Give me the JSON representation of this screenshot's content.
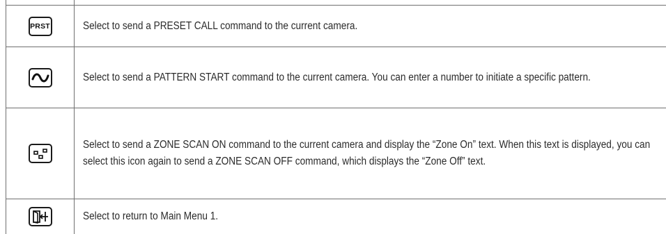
{
  "rows": [
    {
      "icon": "prst-icon",
      "icon_text": "PRST",
      "description": "Select to send a PRESET CALL command to the current camera."
    },
    {
      "icon": "pattern-wave-icon",
      "description": "Select to send a PATTERN START command to the current camera. You can enter a number to initiate a specific pattern."
    },
    {
      "icon": "zone-scan-icon",
      "description": "Select to send a ZONE SCAN ON command to the current   camera and display the “Zone On” text. When this text is displayed, you can select this icon again to send a ZONE SCAN OFF command, which displays the “Zone Off” text."
    },
    {
      "icon": "exit-door-icon",
      "description": "Select to return to Main Menu 1."
    }
  ]
}
